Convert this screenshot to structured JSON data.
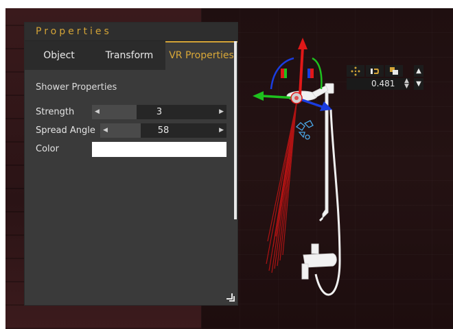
{
  "panel": {
    "title": "Properties",
    "tabs": [
      {
        "label": "Object",
        "active": false
      },
      {
        "label": "Transform",
        "active": false
      },
      {
        "label": "VR Properties",
        "active": true
      }
    ],
    "section_title": "Shower Properties",
    "properties": [
      {
        "label": "Strength",
        "value": "3",
        "fill_fraction": 0.33
      },
      {
        "label": "Spread Angle",
        "value": "58",
        "fill_fraction": 0.32
      }
    ],
    "color_label": "Color",
    "color_value": "#ffffff"
  },
  "mini_toolbar": {
    "value": "0.481",
    "icons": [
      "move-icon",
      "magnet-icon",
      "copy-icon"
    ]
  },
  "colors": {
    "accent": "#d4a437",
    "panel_bg": "#3a3a3a",
    "gizmo_x": "#1ec11e",
    "gizmo_y": "#e01818",
    "gizmo_z": "#1a3de0"
  }
}
